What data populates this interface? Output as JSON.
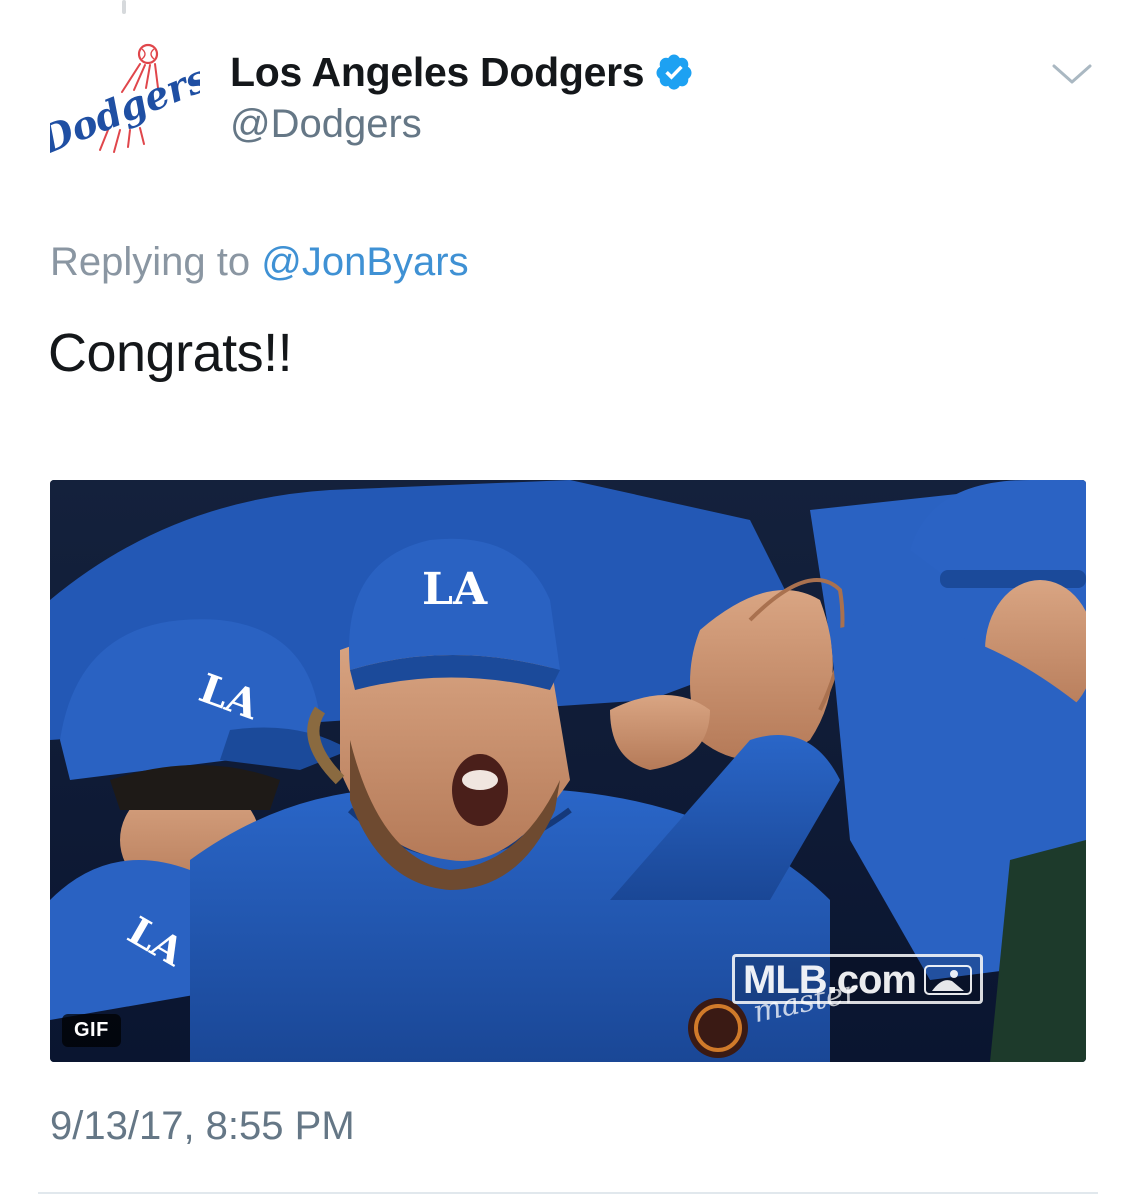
{
  "tweet": {
    "author": {
      "display_name": "Los Angeles Dodgers",
      "handle": "@Dodgers",
      "verified": true,
      "avatar_logo_text": "Dodgers"
    },
    "reply_context": {
      "prefix": "Replying to ",
      "mention": "@JonByars"
    },
    "text": "Congrats!!",
    "media": {
      "type": "gif",
      "badge": "GIF",
      "watermark": "MLB.com",
      "sponsor_text": "master",
      "cap_logo": "LA"
    },
    "timestamp": "9/13/17, 8:55 PM"
  },
  "colors": {
    "verified_blue": "#1da1f2",
    "link_blue": "#3f91d4",
    "dodger_blue": "#1f4fa3",
    "secondary_text": "#657786"
  },
  "icons": {
    "verified": "verified-badge-icon",
    "menu": "chevron-down-icon"
  }
}
